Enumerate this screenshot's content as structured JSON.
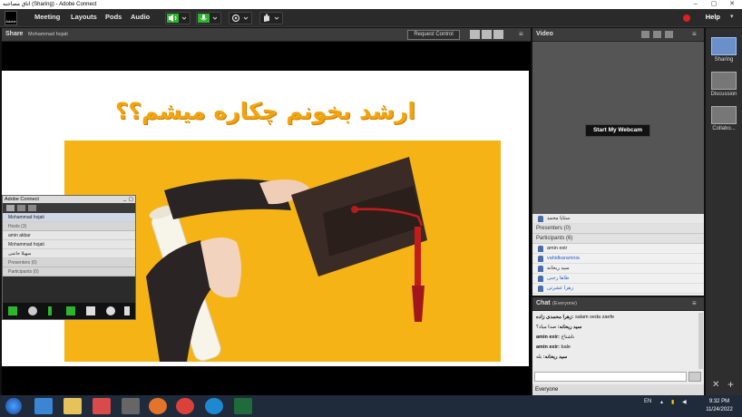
{
  "window": {
    "title": "اتاق مصاحبه (Sharing) - Adobe Connect",
    "minimize": "–",
    "maximize": "▢",
    "close": "✕"
  },
  "menubar": {
    "logo_text": "Adobe",
    "items": [
      "Meeting",
      "Layouts",
      "Pods",
      "Audio"
    ],
    "help": "Help"
  },
  "share_pod": {
    "title": "Share",
    "presenter": "Mohammad hojati",
    "request_control": "Request Control",
    "slide_title": "ارشد بخونم چکاره میشم؟؟"
  },
  "mini_panel": {
    "title": "Adobe Connect",
    "current_user": "Mohammad hojati",
    "hosts_label": "Hosts (3)",
    "hosts": [
      "amin akbar",
      "Mohammad hojati",
      "سهیلا حاتمی"
    ],
    "presenters_label": "Presenters (0)",
    "participants_label": "Participants (0)"
  },
  "video_pod": {
    "title": "Video",
    "webcam_button": "Start My Webcam"
  },
  "attendee_pod": {
    "top_row": "ستایا محمد",
    "presenters_label": "Presenters (0)",
    "participants_label": "Participants (6)",
    "participants": [
      {
        "name": "amin exir",
        "link": false
      },
      {
        "name": "vahidkaramnia",
        "link": true
      },
      {
        "name": "سید ریحانه",
        "link": false
      },
      {
        "name": "طاها رجبی",
        "link": true
      },
      {
        "name": "زهرا عشرتی",
        "link": true
      }
    ]
  },
  "chat_pod": {
    "title": "Chat",
    "audience": "(Everyone)",
    "messages": [
      {
        "author": "زهرا محمدی زاده:",
        "text": "salam seda zaefe"
      },
      {
        "author": "سید ریحانه:",
        "text": "صدا میاد؟"
      },
      {
        "author": "amin exir:",
        "text": "ناشناخ"
      },
      {
        "author": "amin exir:",
        "text": "bale"
      },
      {
        "author": "سید ریحانه:",
        "text": "بله"
      }
    ],
    "footer": "Everyone"
  },
  "layouts": [
    {
      "label": "Sharing"
    },
    {
      "label": "Discussion"
    },
    {
      "label": "Collabo..."
    }
  ],
  "taskbar": {
    "lang": "EN",
    "time": "9:32 PM",
    "date": "11/24/2022"
  },
  "colors": {
    "accent_green": "#2db52d",
    "slide_title": "#f2a40d",
    "photo_bg": "#f5b316",
    "record": "#e02020"
  }
}
